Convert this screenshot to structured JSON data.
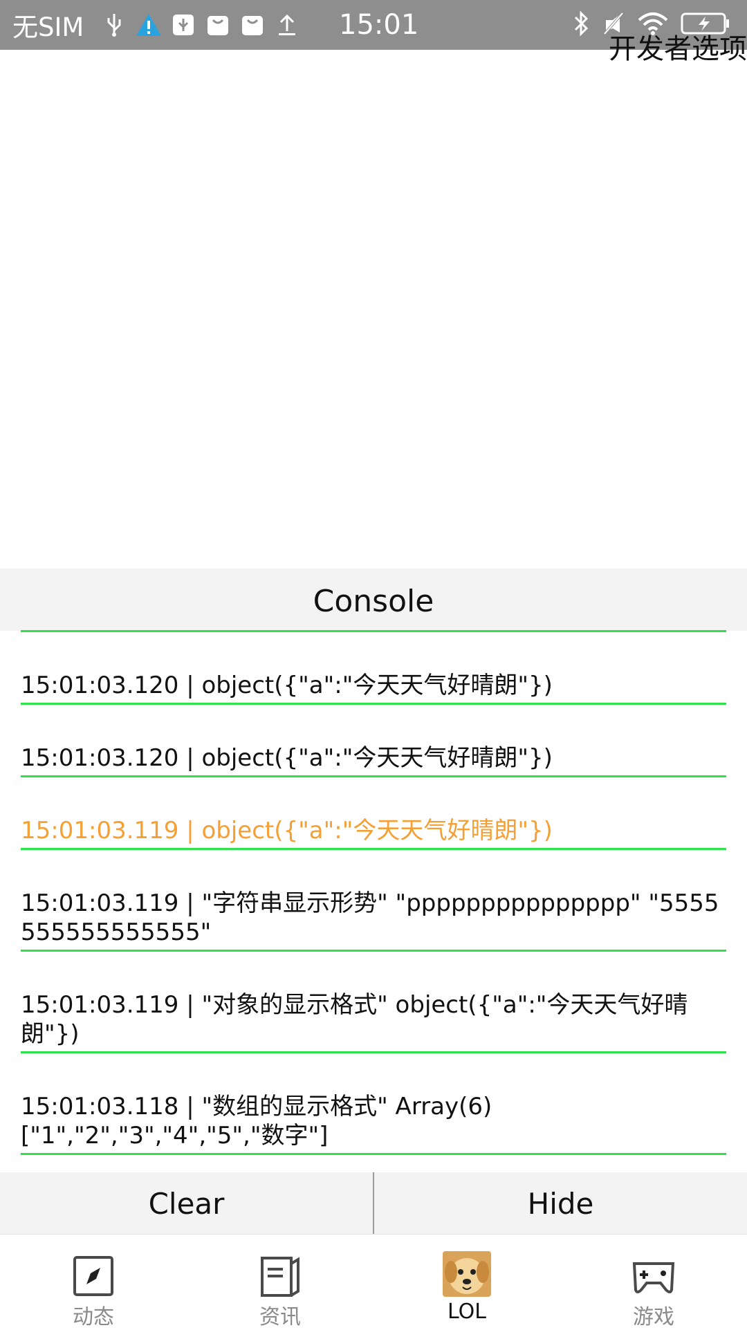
{
  "status_bar": {
    "carrier": "无SIM",
    "time": "15:01",
    "icons_left": [
      "usb-icon",
      "warning-icon",
      "usb-debug-icon",
      "bag-icon",
      "bag-icon",
      "upload-icon"
    ],
    "icons_right": [
      "bluetooth-icon",
      "mute-icon",
      "wifi-icon",
      "battery-charging-icon"
    ],
    "overlay_label": "开发者选项"
  },
  "console": {
    "title": "Console",
    "logs": [
      {
        "text": "15:01:03.120 | object({\"a\":\"今天天气好晴朗\"})",
        "level": "log"
      },
      {
        "text": "15:01:03.120 | object({\"a\":\"今天天气好晴朗\"})",
        "level": "log"
      },
      {
        "text": "15:01:03.119 | object({\"a\":\"今天天气好晴朗\"})",
        "level": "warn"
      },
      {
        "text": "15:01:03.119 | \"字符串显示形势\" \"ppppppppppppppp\" \"5555555555555555\"",
        "level": "log"
      },
      {
        "text": "15:01:03.119 | \"对象的显示格式\" object({\"a\":\"今天天气好晴朗\"})",
        "level": "log"
      },
      {
        "text": "15:01:03.118 | \"数组的显示格式\" Array(6) [\"1\",\"2\",\"3\",\"4\",\"5\",\"数字\"]",
        "level": "log"
      }
    ],
    "clear_label": "Clear",
    "hide_label": "Hide"
  },
  "tabs": [
    {
      "label": "动态",
      "icon": "compass-icon",
      "active": false
    },
    {
      "label": "资讯",
      "icon": "news-icon",
      "active": false
    },
    {
      "label": "LOL",
      "icon": "dog-avatar-icon",
      "active": true
    },
    {
      "label": "游戏",
      "icon": "gamepad-icon",
      "active": false
    }
  ],
  "colors": {
    "status_bar_bg": "#8e8e8e",
    "divider_green": "#2ee04a",
    "warn_orange": "#f4a035",
    "panel_bg": "#f2f3f2"
  }
}
